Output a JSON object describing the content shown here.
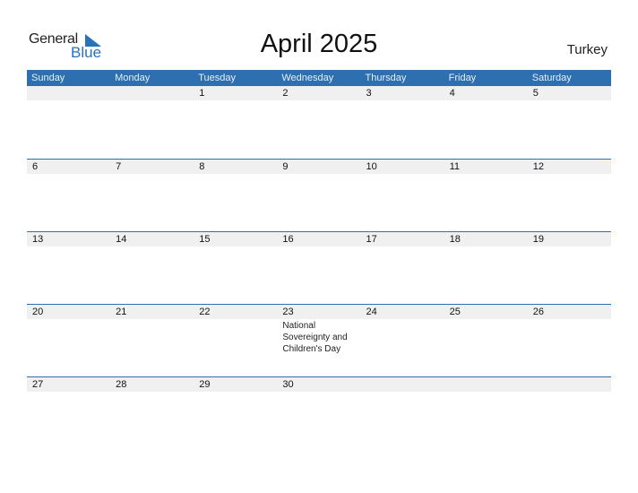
{
  "logo": {
    "word1": "General",
    "word2": "Blue"
  },
  "title": "April 2025",
  "country": "Turkey",
  "weekdays": [
    "Sunday",
    "Monday",
    "Tuesday",
    "Wednesday",
    "Thursday",
    "Friday",
    "Saturday"
  ],
  "weeks": [
    [
      {
        "day": ""
      },
      {
        "day": ""
      },
      {
        "day": "1"
      },
      {
        "day": "2"
      },
      {
        "day": "3"
      },
      {
        "day": "4"
      },
      {
        "day": "5"
      }
    ],
    [
      {
        "day": "6"
      },
      {
        "day": "7"
      },
      {
        "day": "8"
      },
      {
        "day": "9"
      },
      {
        "day": "10"
      },
      {
        "day": "11"
      },
      {
        "day": "12"
      }
    ],
    [
      {
        "day": "13"
      },
      {
        "day": "14"
      },
      {
        "day": "15"
      },
      {
        "day": "16"
      },
      {
        "day": "17"
      },
      {
        "day": "18"
      },
      {
        "day": "19"
      }
    ],
    [
      {
        "day": "20"
      },
      {
        "day": "21"
      },
      {
        "day": "22"
      },
      {
        "day": "23",
        "event": "National Sovereignty and Children's Day"
      },
      {
        "day": "24"
      },
      {
        "day": "25"
      },
      {
        "day": "26"
      }
    ],
    [
      {
        "day": "27"
      },
      {
        "day": "28"
      },
      {
        "day": "29"
      },
      {
        "day": "30"
      },
      {
        "day": ""
      },
      {
        "day": ""
      },
      {
        "day": ""
      }
    ]
  ],
  "colors": {
    "accent": "#2d6faf",
    "band": "#f0f0f0"
  }
}
